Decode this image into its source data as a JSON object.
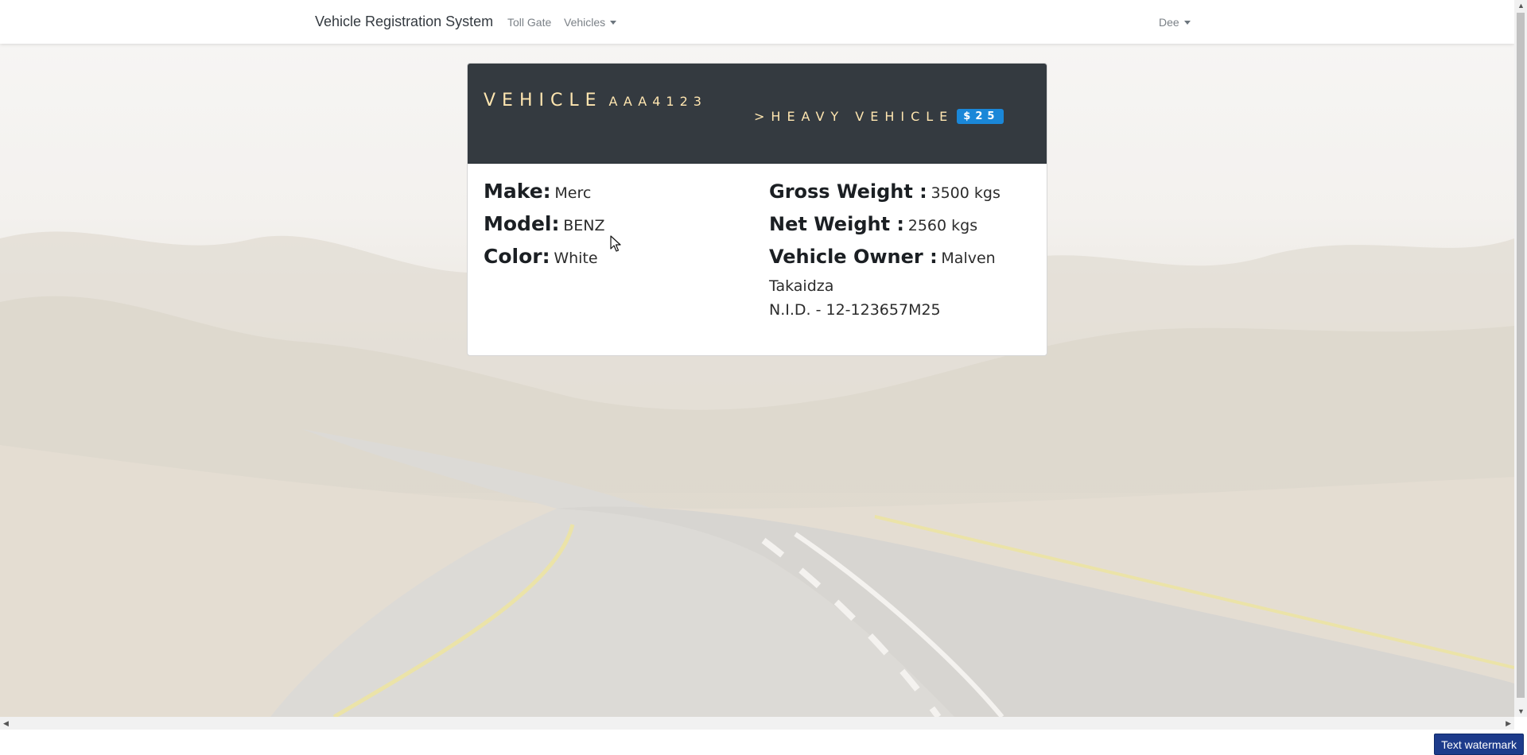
{
  "navbar": {
    "brand": "Vehicle Registration System",
    "links": [
      {
        "label": "Toll Gate",
        "dropdown": false
      },
      {
        "label": "Vehicles",
        "dropdown": true
      }
    ],
    "user_menu": {
      "label": "Dee",
      "dropdown": true
    }
  },
  "vehicle_card": {
    "title_word": "VEHICLE",
    "plate_number": "AAA4123",
    "class_label": ">HEAVY VEHICLE",
    "fee": "$25",
    "left_fields": [
      {
        "label": "Make:",
        "value": "Merc"
      },
      {
        "label": "Model:",
        "value": "BENZ"
      },
      {
        "label": "Color:",
        "value": "White"
      }
    ],
    "gross_weight": {
      "label": "Gross Weight :",
      "value": "3500 kgs"
    },
    "net_weight": {
      "label": "Net Weight :",
      "value": "2560 kgs"
    },
    "owner": {
      "label": "Vehicle Owner :",
      "first_name": "Malven",
      "last_name": "Takaidza",
      "nid": "N.I.D. - 12-123657M25"
    }
  },
  "watermark": "Text watermark",
  "colors": {
    "header_bg": "#343a40",
    "header_text": "#ffe6b0",
    "fee_badge": "#1a87d8",
    "watermark_bg": "#1d3b8b"
  }
}
